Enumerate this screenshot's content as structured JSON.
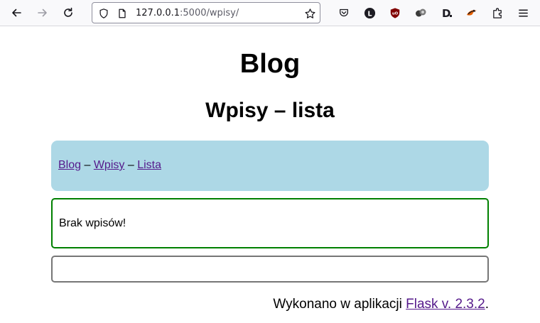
{
  "browser": {
    "url_host": "127.0.0.1",
    "url_rest": ":5000/wpisy/",
    "icons": [
      "back-icon",
      "forward-icon",
      "reload-icon",
      "shield-icon",
      "page-icon",
      "bookmark-star-icon",
      "pocket-icon",
      "extension-l-icon",
      "ublock-icon",
      "extension-dots-icon",
      "extension-d-icon",
      "extension-cat-icon",
      "extensions-puzzle-icon",
      "menu-icon"
    ]
  },
  "page": {
    "site_title": "Blog",
    "heading": "Wpisy – lista",
    "breadcrumb": {
      "items": [
        "Blog",
        "Wpisy",
        "Lista"
      ],
      "separator": "–"
    },
    "message": "Brak wpisów!",
    "footer": {
      "prefix": "Wykonano w aplikacji ",
      "link": "Flask v. 2.3.2",
      "suffix": "."
    }
  },
  "colors": {
    "breadcrumb_bg": "#add8e6",
    "message_border": "#008000",
    "link": "#551a8b"
  }
}
